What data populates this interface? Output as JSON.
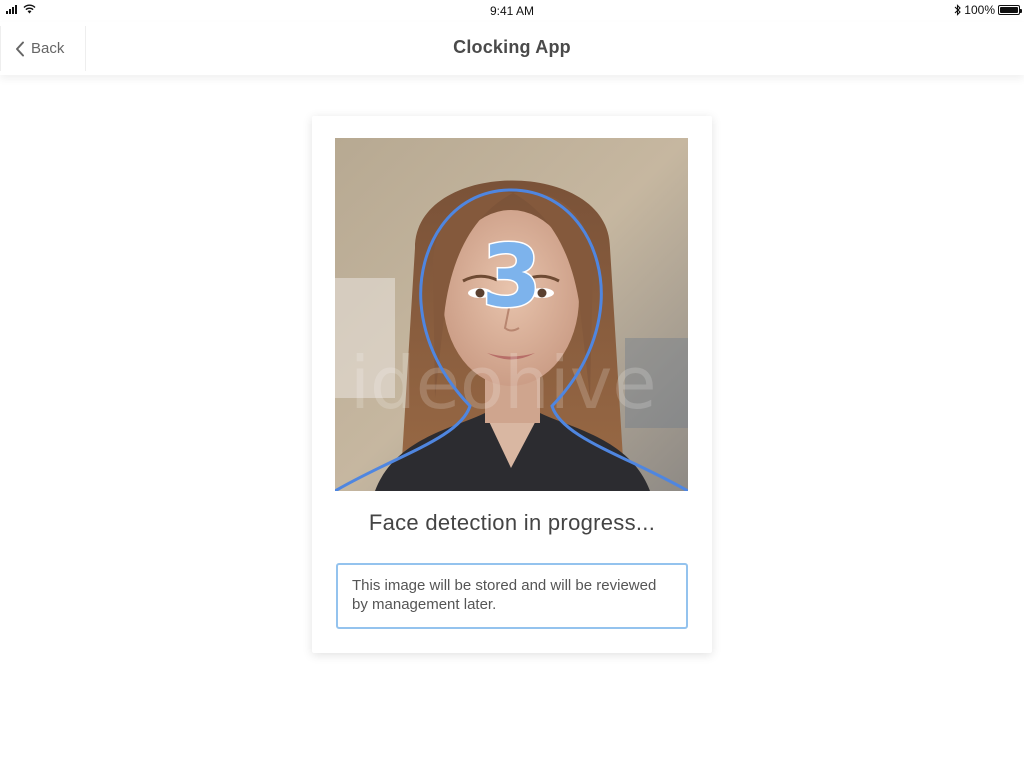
{
  "status_bar": {
    "time": "9:41 AM",
    "battery": "100%",
    "icons": [
      "signal-icon",
      "wifi-icon",
      "bluetooth-icon",
      "battery-icon"
    ]
  },
  "nav": {
    "back_label": "Back",
    "title": "Clocking App"
  },
  "capture": {
    "countdown": "3",
    "status": "Face detection in progress...",
    "notice": "This image will be stored and will be reviewed by management later."
  },
  "colors": {
    "accent": "#7db3ec",
    "outline": "#4f86e0",
    "notice_border": "#94c3ee"
  }
}
